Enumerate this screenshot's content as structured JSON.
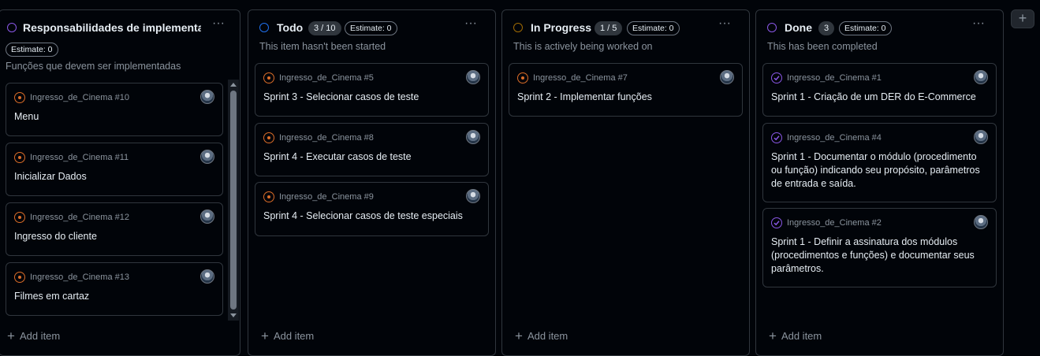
{
  "columns": [
    {
      "title": "Responsabilidades de implementação",
      "count": "",
      "estimate": "Estimate: 0",
      "description": "Funções que devem ser implementadas",
      "status_color": "#8957e5",
      "add_item": "Add item",
      "cards": [
        {
          "ref": "Ingresso_de_Cinema #10",
          "title": "Menu",
          "state": "open"
        },
        {
          "ref": "Ingresso_de_Cinema #11",
          "title": "Inicializar Dados",
          "state": "open"
        },
        {
          "ref": "Ingresso_de_Cinema #12",
          "title": "Ingresso do cliente",
          "state": "open"
        },
        {
          "ref": "Ingresso_de_Cinema #13",
          "title": "Filmes em cartaz",
          "state": "open"
        }
      ]
    },
    {
      "title": "Todo",
      "count": "3 / 10",
      "estimate": "Estimate: 0",
      "description": "This item hasn't been started",
      "status_color": "#1f6feb",
      "add_item": "Add item",
      "cards": [
        {
          "ref": "Ingresso_de_Cinema #5",
          "title": "Sprint 3 - Selecionar casos de teste",
          "state": "open"
        },
        {
          "ref": "Ingresso_de_Cinema #8",
          "title": "Sprint 4 - Executar casos de teste",
          "state": "open"
        },
        {
          "ref": "Ingresso_de_Cinema #9",
          "title": "Sprint 4 - Selecionar casos de teste especiais",
          "state": "open"
        }
      ]
    },
    {
      "title": "In Progress",
      "count": "1 / 5",
      "estimate": "Estimate: 0",
      "description": "This is actively being worked on",
      "status_color": "#9e6a03",
      "add_item": "Add item",
      "cards": [
        {
          "ref": "Ingresso_de_Cinema #7",
          "title": "Sprint 2 - Implementar funções",
          "state": "open"
        }
      ]
    },
    {
      "title": "Done",
      "count": "3",
      "estimate": "Estimate: 0",
      "description": "This has been completed",
      "status_color": "#8957e5",
      "add_item": "Add item",
      "cards": [
        {
          "ref": "Ingresso_de_Cinema #1",
          "title": "Sprint 1 - Criação de um DER do E-Commerce",
          "state": "closed"
        },
        {
          "ref": "Ingresso_de_Cinema #4",
          "title": "Sprint 1 - Documentar o módulo (procedimento ou função) indicando seu propósito, parâmetros de entrada e saída.",
          "state": "closed"
        },
        {
          "ref": "Ingresso_de_Cinema #2",
          "title": "Sprint 1 - Definir a assinatura dos módulos (procedimentos e funções) e documentar seus parâmetros.",
          "state": "closed"
        }
      ]
    }
  ],
  "add_column": "+",
  "more_icon": "···",
  "icons": {
    "more": "kebab-horizontal-icon",
    "issue_open": "issue-opened-icon",
    "issue_closed": "issue-closed-icon",
    "plus": "plus-icon"
  }
}
